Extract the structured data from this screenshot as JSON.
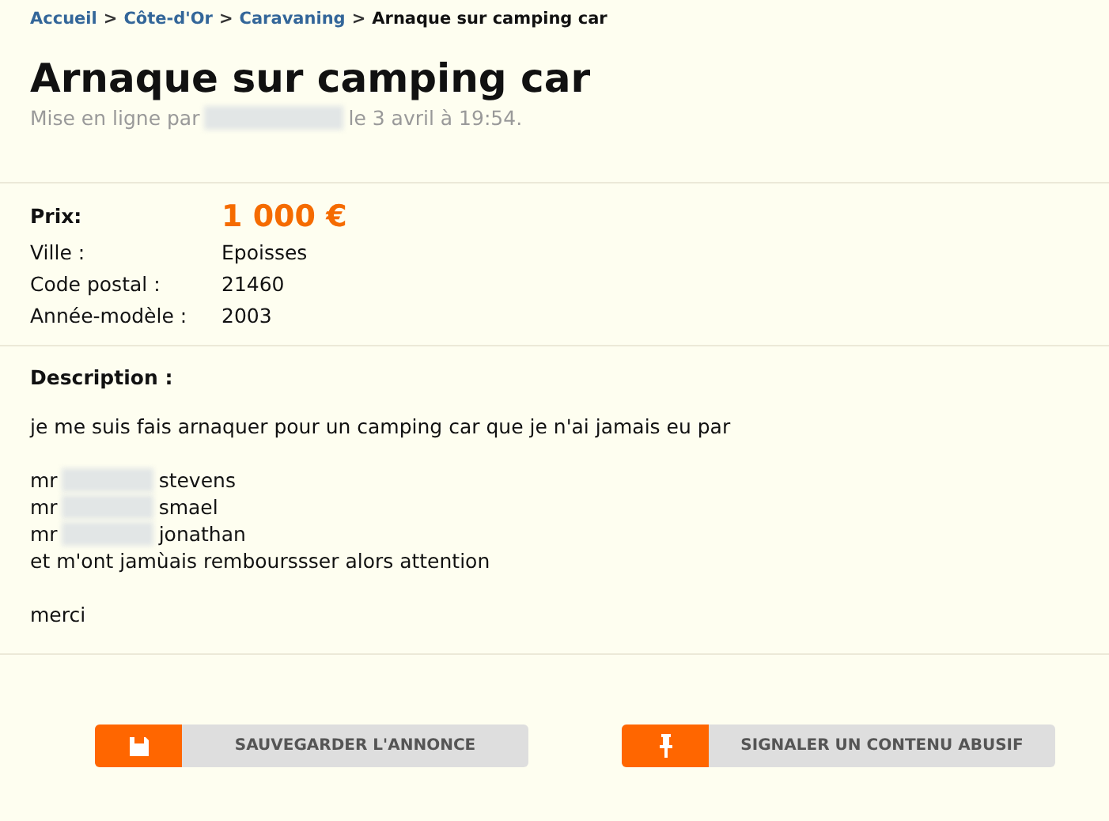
{
  "breadcrumb": [
    {
      "label": "Accueil",
      "current": false
    },
    {
      "label": "Côte-d'Or",
      "current": false
    },
    {
      "label": "Caravaning",
      "current": false
    },
    {
      "label": "Arnaque sur camping car",
      "current": true
    }
  ],
  "separator": ">",
  "title": "Arnaque sur camping car",
  "posted": {
    "before": "Mise en ligne par",
    "author_blurred": true,
    "after": "le 3 avril à 19:54."
  },
  "price": {
    "label": "Prix:",
    "value": "1 000 €"
  },
  "details": [
    {
      "label": "Ville :",
      "value": "Epoisses"
    },
    {
      "label": "Code postal :",
      "value": "21460"
    },
    {
      "label": "Année-modèle :",
      "value": "2003"
    }
  ],
  "description": {
    "heading": "Description :",
    "lines": [
      {
        "kind": "text",
        "text": "je me suis fais arnaquer pour un camping car que je n'ai jamais eu par"
      },
      {
        "kind": "blank"
      },
      {
        "kind": "name",
        "before": "mr",
        "after": "stevens"
      },
      {
        "kind": "name",
        "before": "mr",
        "after": "smael"
      },
      {
        "kind": "name",
        "before": "mr",
        "after": "jonathan"
      },
      {
        "kind": "text",
        "text": "et m'ont jamùais rembourssser alors attention"
      },
      {
        "kind": "blank"
      },
      {
        "kind": "text",
        "text": "merci"
      }
    ]
  },
  "buttons": [
    {
      "label": "SAUVEGARDER L'ANNONCE",
      "kind": "save"
    },
    {
      "label": "SIGNALER UN CONTENU ABUSIF",
      "kind": "report"
    }
  ]
}
